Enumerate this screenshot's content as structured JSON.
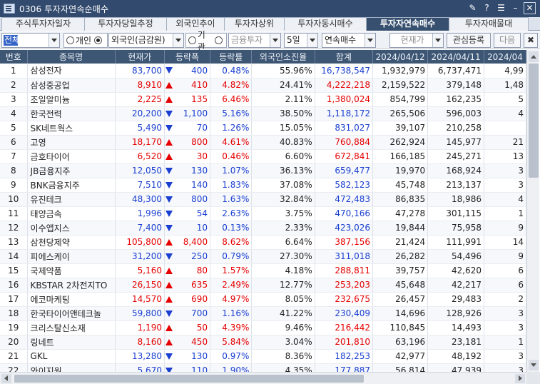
{
  "window": {
    "title": "0306 투자자연속순매수"
  },
  "tabs": [
    "주식투자자일자",
    "투자자당일추정",
    "외국인추이",
    "투자자상위",
    "투자자동시매수",
    "투자자연속매수",
    "투자자매물대"
  ],
  "active_tab": "투자자연속매수",
  "toolbar": {
    "market_value": "전체",
    "radio_individual": "개인",
    "radio_foreign": "외국인(금감원)",
    "radio_institution": "기관",
    "institution_type": "금융투자",
    "period": "5일",
    "mode": "연속매수",
    "price_type": "현재가",
    "watch_button": "관심등록",
    "next_button": "다음"
  },
  "columns": [
    "번호",
    "종목명",
    "현재가",
    "등락폭",
    "등락률",
    "외국인소진율",
    "합계",
    "2024/04/12",
    "2024/04/11",
    "2024/04"
  ],
  "colors": {
    "up": "#e60000",
    "down": "#1a3fd1",
    "header": "#3d5674",
    "title": "#324a6e"
  },
  "rows": [
    {
      "no": "1",
      "name": "삼성전자",
      "price": "83,700",
      "dir": "dn",
      "chg": "400",
      "rate": "0.48%",
      "foreign": "55.96%",
      "total": "16,738,547",
      "d1": "1,932,979",
      "d2": "6,737,471",
      "d3": "4,99"
    },
    {
      "no": "2",
      "name": "삼성중공업",
      "price": "8,910",
      "dir": "up",
      "chg": "410",
      "rate": "4.82%",
      "foreign": "24.41%",
      "total": "4,222,218",
      "d1": "2,159,522",
      "d2": "379,148",
      "d3": "1,48"
    },
    {
      "no": "3",
      "name": "조일알미늄",
      "price": "2,225",
      "dir": "up",
      "chg": "135",
      "rate": "6.46%",
      "foreign": "2.11%",
      "total": "1,380,024",
      "d1": "854,799",
      "d2": "162,235",
      "d3": "5"
    },
    {
      "no": "4",
      "name": "한국전력",
      "price": "20,200",
      "dir": "dn",
      "chg": "1,100",
      "rate": "5.16%",
      "foreign": "38.50%",
      "total": "1,118,172",
      "d1": "265,506",
      "d2": "596,003",
      "d3": "4"
    },
    {
      "no": "5",
      "name": "SK네트웍스",
      "price": "5,490",
      "dir": "dn",
      "chg": "70",
      "rate": "1.26%",
      "foreign": "15.05%",
      "total": "831,027",
      "d1": "39,107",
      "d2": "210,258",
      "d3": ""
    },
    {
      "no": "6",
      "name": "고영",
      "price": "18,170",
      "dir": "up",
      "chg": "800",
      "rate": "4.61%",
      "foreign": "40.83%",
      "total": "760,884",
      "d1": "262,924",
      "d2": "145,977",
      "d3": "21"
    },
    {
      "no": "7",
      "name": "금호타이어",
      "price": "6,520",
      "dir": "up",
      "chg": "30",
      "rate": "0.46%",
      "foreign": "6.60%",
      "total": "672,841",
      "d1": "166,185",
      "d2": "245,271",
      "d3": "13"
    },
    {
      "no": "8",
      "name": "JB금융지주",
      "price": "12,050",
      "dir": "dn",
      "chg": "130",
      "rate": "1.07%",
      "foreign": "36.13%",
      "total": "659,477",
      "d1": "19,970",
      "d2": "168,924",
      "d3": "3"
    },
    {
      "no": "9",
      "name": "BNK금융지주",
      "price": "7,510",
      "dir": "dn",
      "chg": "140",
      "rate": "1.83%",
      "foreign": "37.08%",
      "total": "582,123",
      "d1": "45,748",
      "d2": "213,137",
      "d3": "3"
    },
    {
      "no": "10",
      "name": "유진테크",
      "price": "48,300",
      "dir": "dn",
      "chg": "800",
      "rate": "1.63%",
      "foreign": "32.84%",
      "total": "472,483",
      "d1": "86,835",
      "d2": "18,986",
      "d3": "4"
    },
    {
      "no": "11",
      "name": "태양금속",
      "price": "1,996",
      "dir": "dn",
      "chg": "54",
      "rate": "2.63%",
      "foreign": "3.75%",
      "total": "470,166",
      "d1": "47,278",
      "d2": "301,115",
      "d3": "1"
    },
    {
      "no": "12",
      "name": "이수앱지스",
      "price": "7,400",
      "dir": "dn",
      "chg": "10",
      "rate": "0.13%",
      "foreign": "2.33%",
      "total": "423,026",
      "d1": "19,844",
      "d2": "75,958",
      "d3": "9"
    },
    {
      "no": "13",
      "name": "삼천당제약",
      "price": "105,800",
      "dir": "up",
      "chg": "8,400",
      "rate": "8.62%",
      "foreign": "6.64%",
      "total": "387,156",
      "d1": "21,424",
      "d2": "111,991",
      "d3": "14"
    },
    {
      "no": "14",
      "name": "피에스케이",
      "price": "31,200",
      "dir": "dn",
      "chg": "250",
      "rate": "0.79%",
      "foreign": "27.30%",
      "total": "311,018",
      "d1": "26,282",
      "d2": "54,496",
      "d3": "9"
    },
    {
      "no": "15",
      "name": "국제약품",
      "price": "5,160",
      "dir": "up",
      "chg": "80",
      "rate": "1.57%",
      "foreign": "4.18%",
      "total": "288,811",
      "d1": "39,757",
      "d2": "42,620",
      "d3": "6"
    },
    {
      "no": "16",
      "name": "KBSTAR 2차전지TO",
      "price": "26,150",
      "dir": "up",
      "chg": "635",
      "rate": "2.49%",
      "foreign": "12.77%",
      "total": "253,203",
      "d1": "45,648",
      "d2": "42,217",
      "d3": "6"
    },
    {
      "no": "17",
      "name": "에코마케팅",
      "price": "14,570",
      "dir": "up",
      "chg": "690",
      "rate": "4.97%",
      "foreign": "8.05%",
      "total": "232,675",
      "d1": "26,457",
      "d2": "29,483",
      "d3": "2"
    },
    {
      "no": "18",
      "name": "한국타이어앤테크놀",
      "price": "59,800",
      "dir": "dn",
      "chg": "700",
      "rate": "1.16%",
      "foreign": "41.22%",
      "total": "230,409",
      "d1": "14,696",
      "d2": "128,926",
      "d3": "3"
    },
    {
      "no": "19",
      "name": "크리스탈신소재",
      "price": "1,190",
      "dir": "up",
      "chg": "50",
      "rate": "4.39%",
      "foreign": "9.46%",
      "total": "216,442",
      "d1": "110,845",
      "d2": "14,493",
      "d3": "3"
    },
    {
      "no": "20",
      "name": "링네트",
      "price": "8,160",
      "dir": "up",
      "chg": "450",
      "rate": "5.84%",
      "foreign": "3.04%",
      "total": "201,810",
      "d1": "63,196",
      "d2": "23,181",
      "d3": "1"
    },
    {
      "no": "21",
      "name": "GKL",
      "price": "13,280",
      "dir": "dn",
      "chg": "130",
      "rate": "0.97%",
      "foreign": "8.36%",
      "total": "182,253",
      "d1": "42,977",
      "d2": "48,192",
      "d3": "3"
    },
    {
      "no": "22",
      "name": "와이지원",
      "price": "5,670",
      "dir": "dn",
      "chg": "110",
      "rate": "1.90%",
      "foreign": "4.35%",
      "total": "177,887",
      "d1": "56,814",
      "d2": "47,939",
      "d3": "3"
    }
  ]
}
